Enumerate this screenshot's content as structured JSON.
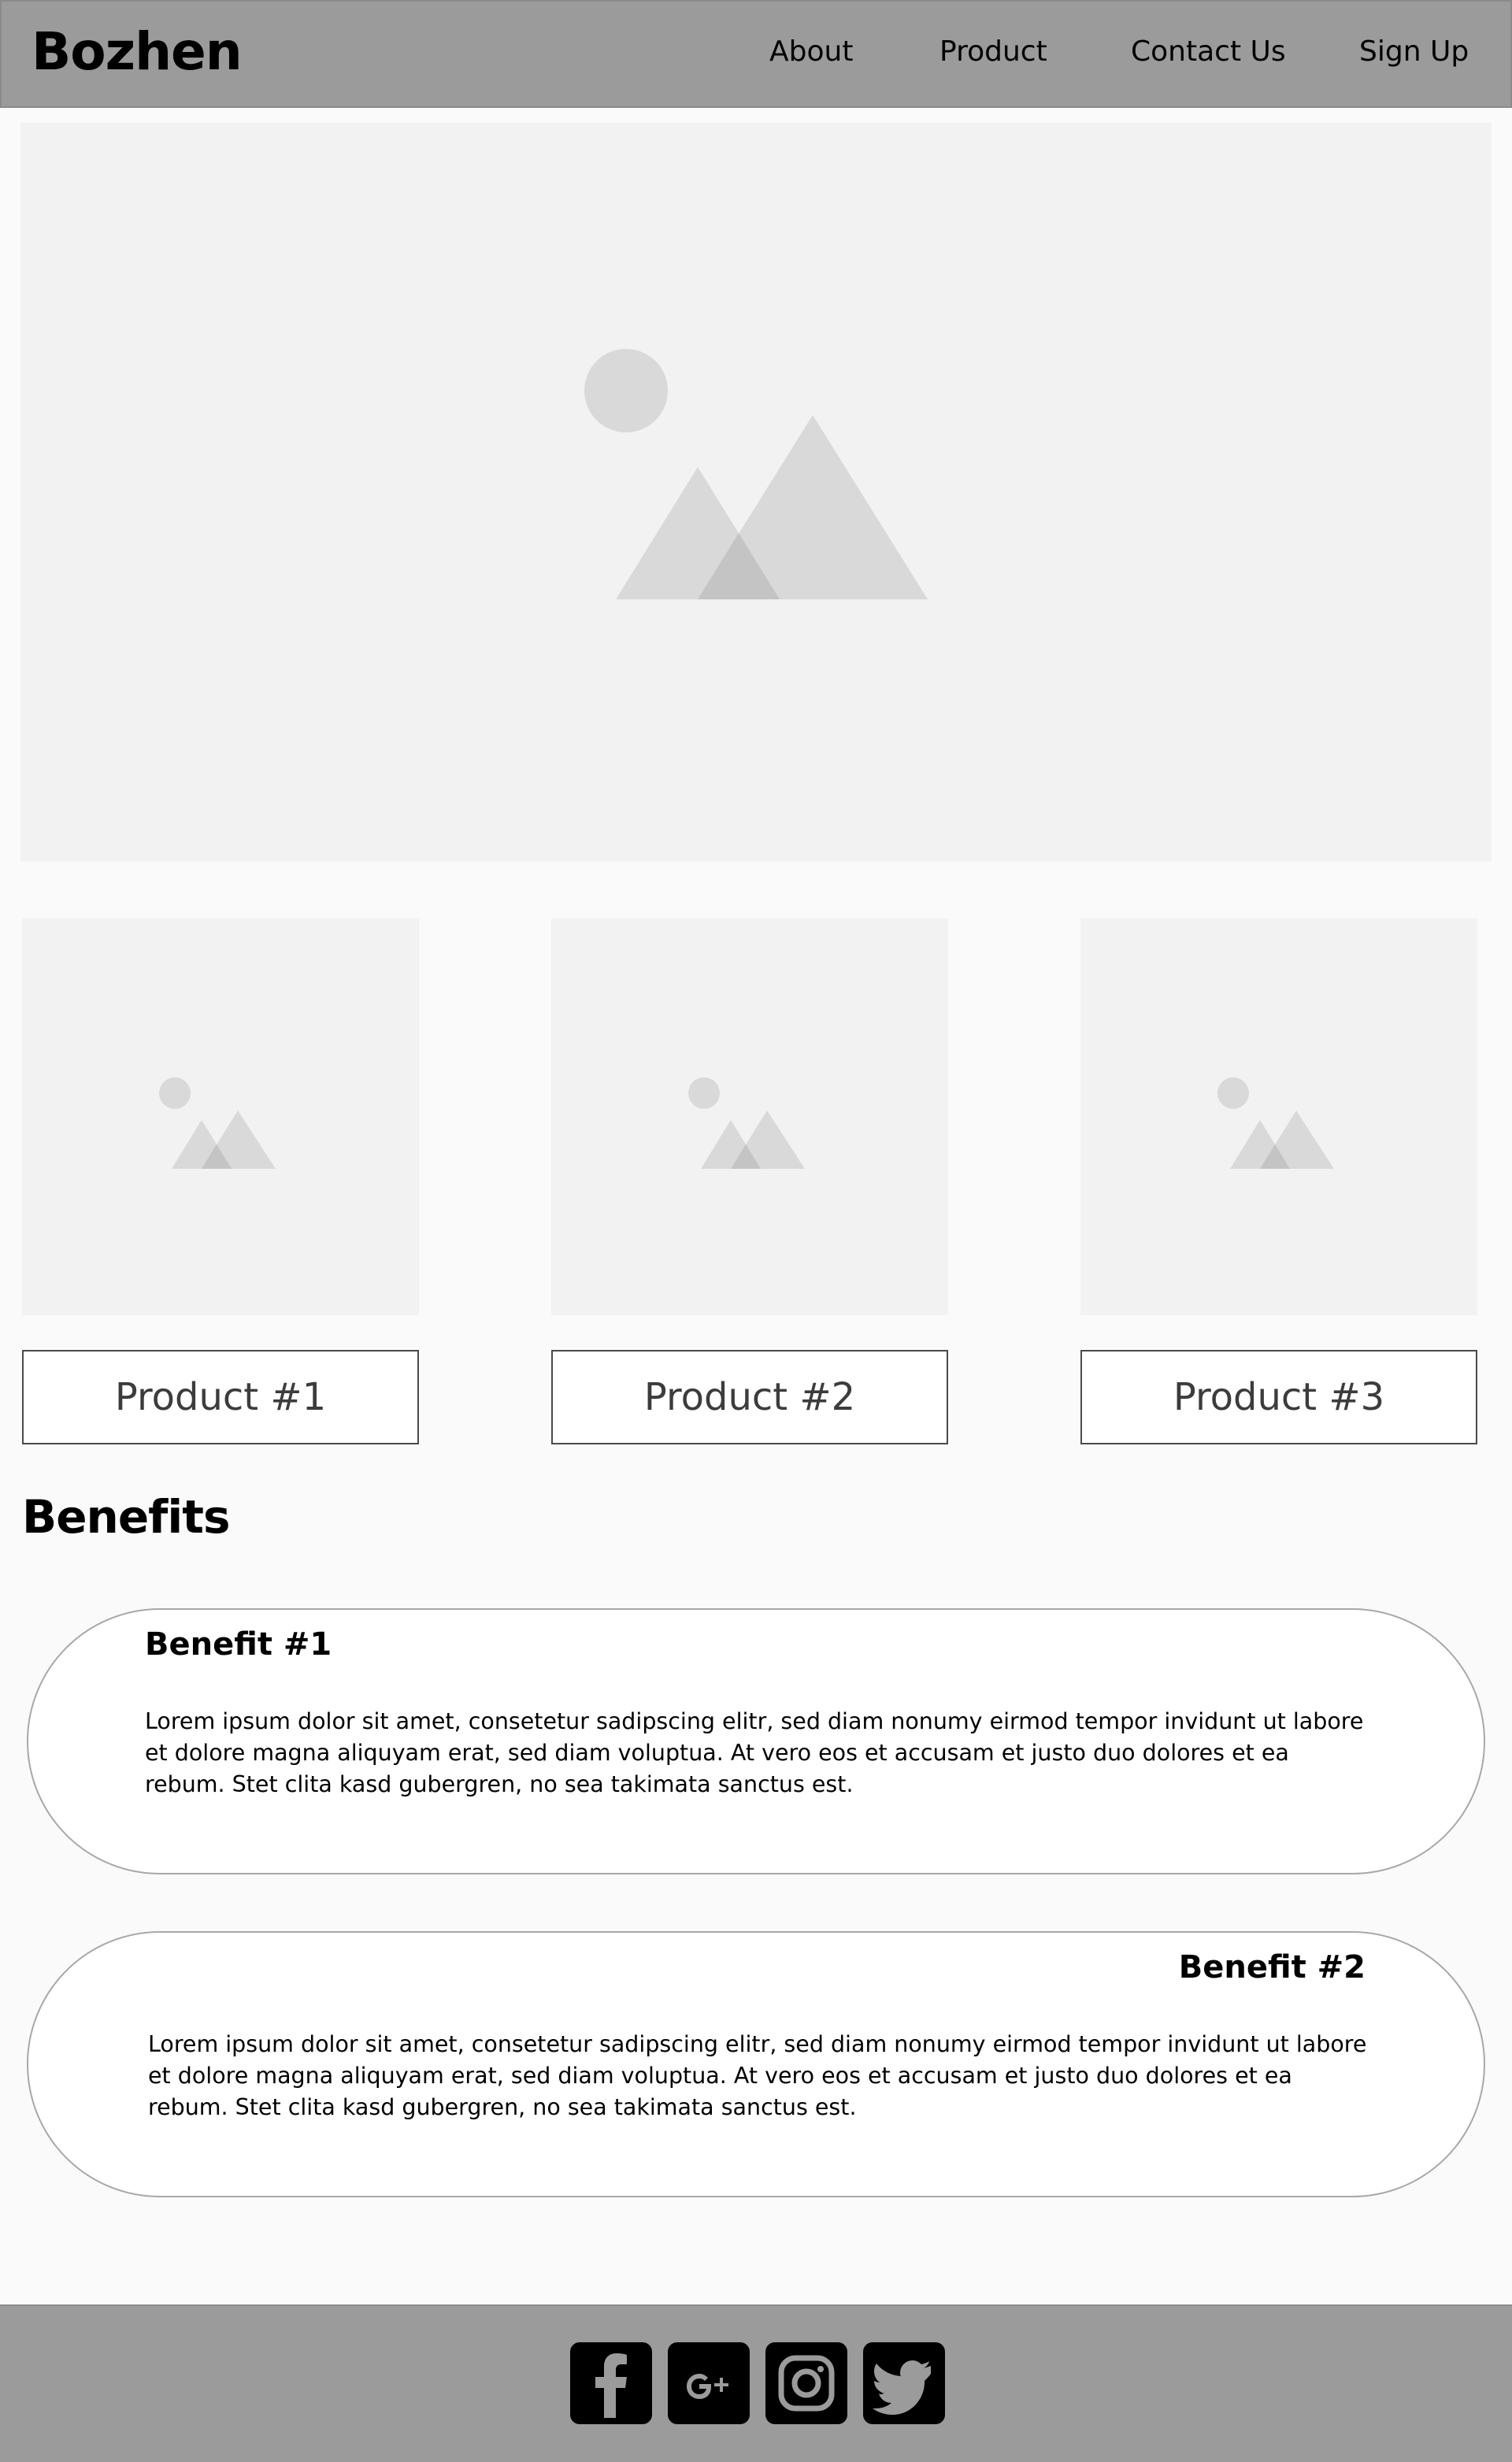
{
  "header": {
    "brand": "Bozhen",
    "nav": [
      {
        "label": "About"
      },
      {
        "label": "Product"
      },
      {
        "label": "Contact Us"
      },
      {
        "label": "Sign Up"
      }
    ]
  },
  "hero": {
    "icon": "image-placeholder-icon"
  },
  "products": [
    {
      "label": "Product #1",
      "icon": "image-placeholder-icon"
    },
    {
      "label": "Product #2",
      "icon": "image-placeholder-icon"
    },
    {
      "label": "Product #3",
      "icon": "image-placeholder-icon"
    }
  ],
  "benefits": {
    "title": "Benefits",
    "items": [
      {
        "heading": "Benefit #1",
        "text": "Lorem ipsum dolor sit amet, consetetur sadipscing elitr, sed diam nonumy eirmod tempor invidunt ut labore et dolore magna aliquyam erat, sed diam voluptua. At vero eos et accusam et justo duo dolores et ea rebum. Stet clita kasd gubergren, no sea takimata sanctus est."
      },
      {
        "heading": "Benefit #2",
        "text": "Lorem ipsum dolor sit amet, consetetur sadipscing elitr, sed diam nonumy eirmod tempor invidunt ut labore et dolore magna aliquyam erat, sed diam voluptua. At vero eos et accusam et justo duo dolores et ea rebum. Stet clita kasd gubergren, no sea takimata sanctus est."
      }
    ]
  },
  "footer": {
    "social": [
      "facebook-icon",
      "google-plus-icon",
      "instagram-icon",
      "twitter-icon"
    ]
  },
  "colors": {
    "header_bg": "#9b9b9b",
    "page_bg": "#fafafa",
    "placeholder_bg": "#f2f2f2",
    "placeholder_shape": "#d9d9d9"
  }
}
